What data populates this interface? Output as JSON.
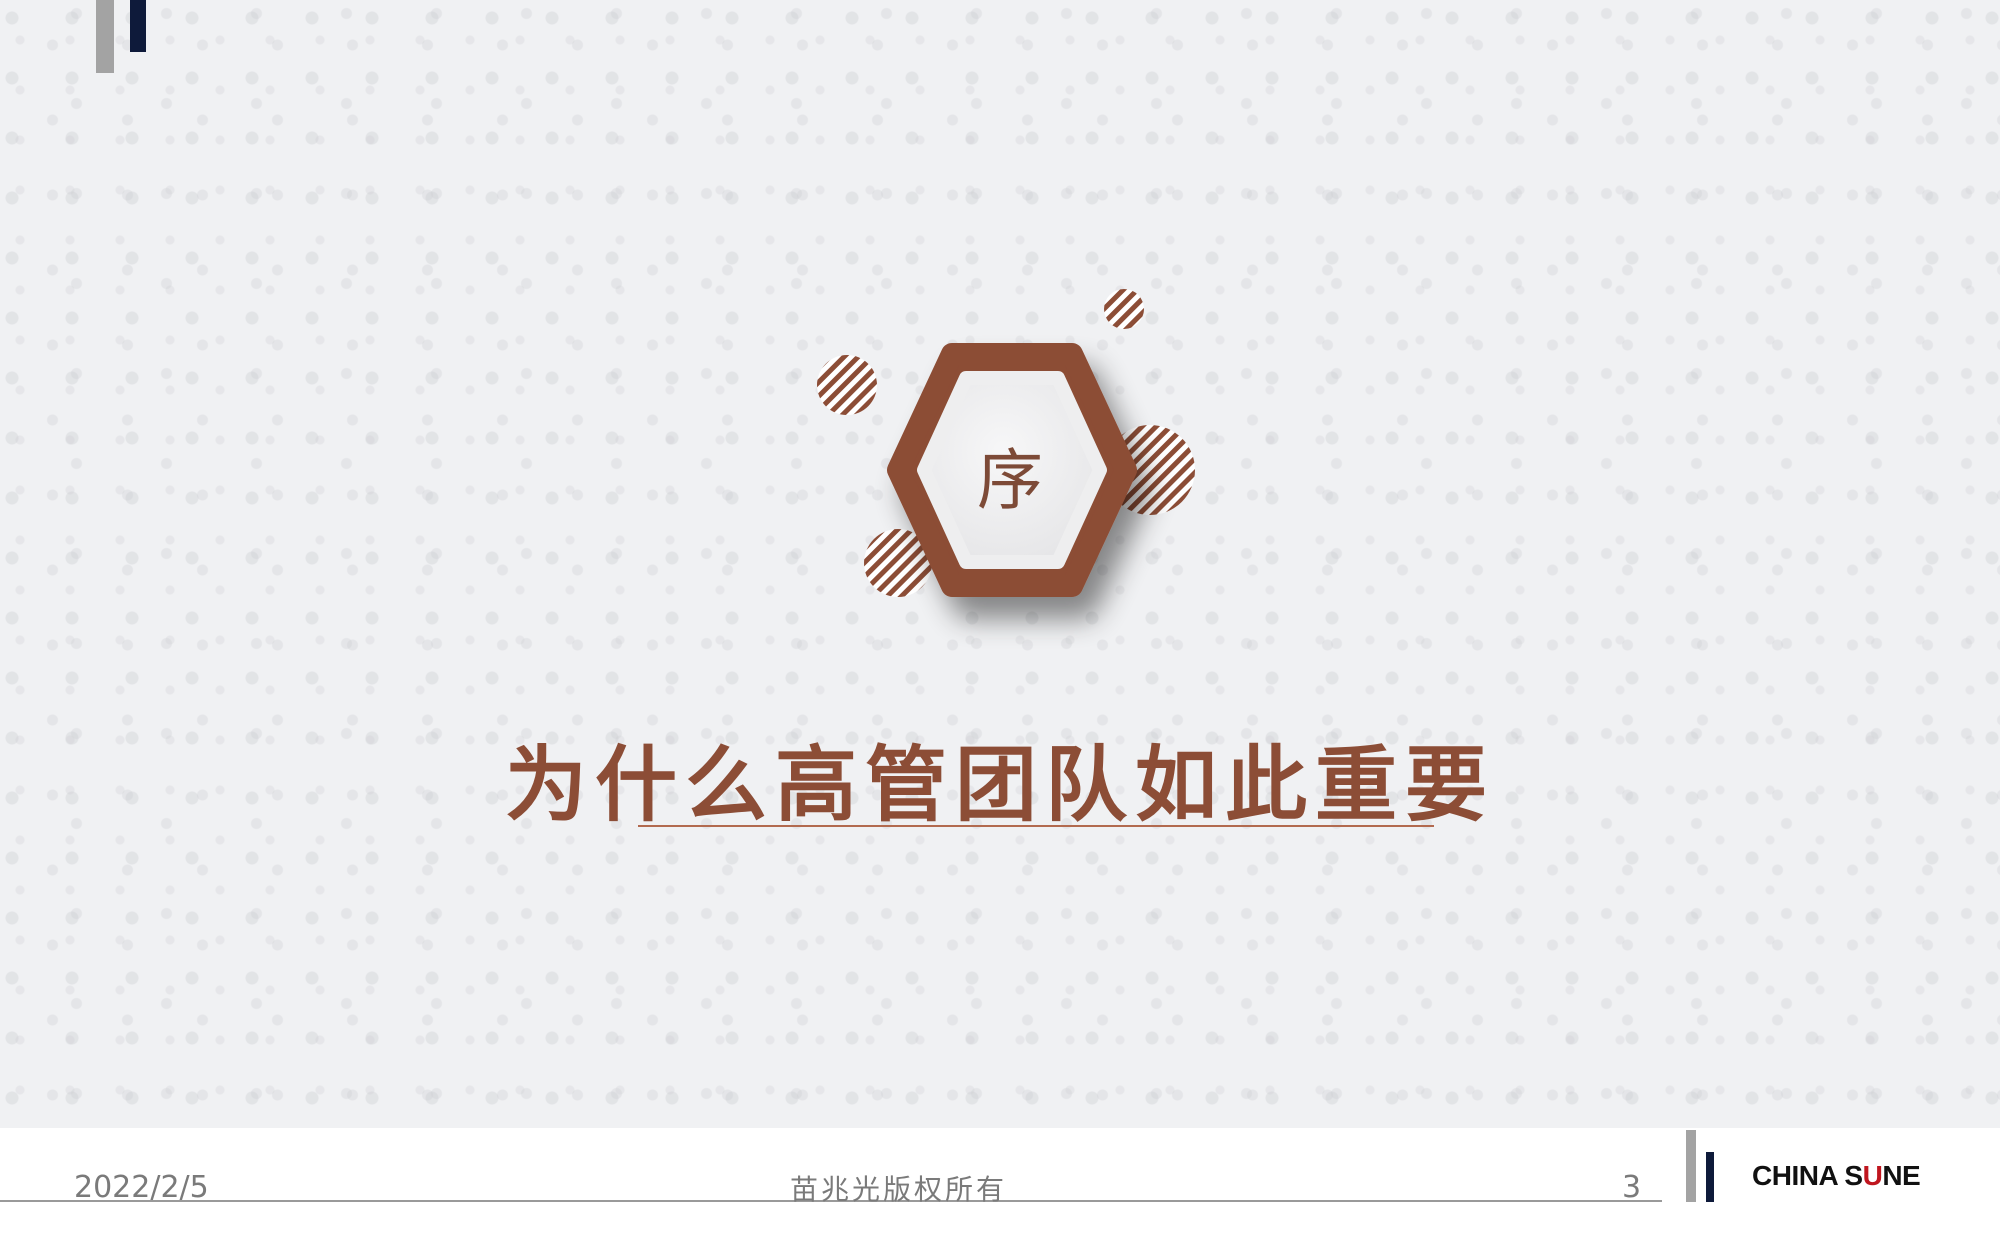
{
  "slide": {
    "section_marker": "序",
    "title": "为什么高管团队如此重要"
  },
  "footer": {
    "date": "2022/2/5",
    "copyright": "苗兆光版权所有",
    "page_number": "3",
    "logo_text_left": "CHINA S",
    "logo_text_accent": "U",
    "logo_text_right": "NE"
  },
  "colors": {
    "accent_brown": "#8c4d36",
    "navy": "#0e1a3a",
    "logo_red": "#c0161f"
  }
}
